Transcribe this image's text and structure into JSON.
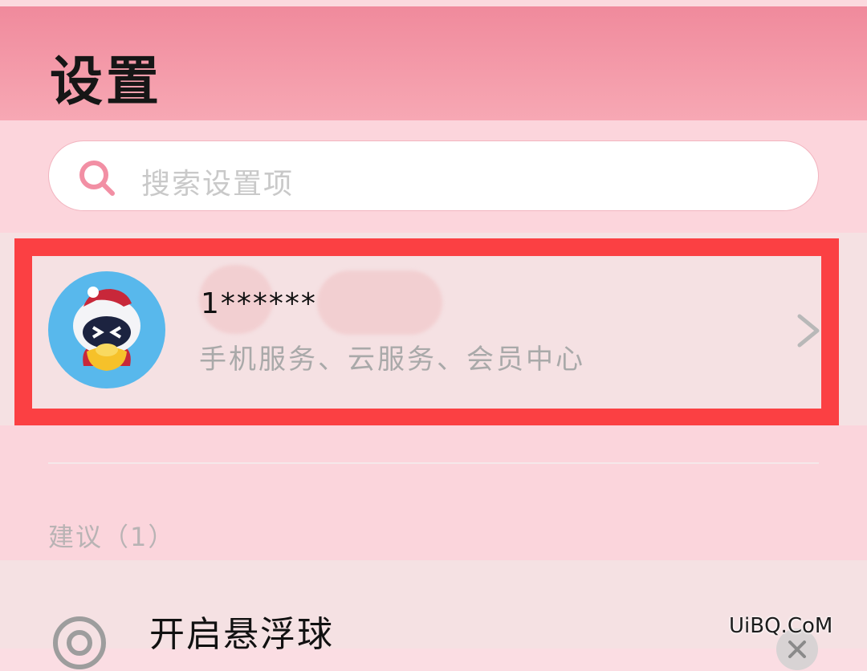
{
  "header": {
    "title": "设置"
  },
  "search": {
    "placeholder": "搜索设置项"
  },
  "account": {
    "name": "1******",
    "subtitle": "手机服务、云服务、会员中心"
  },
  "suggestions": {
    "section_label": "建议（1）",
    "items": [
      {
        "label": "开启悬浮球"
      }
    ]
  },
  "watermark": "UiBQ.CoM",
  "colors": {
    "header": "#f08a9c",
    "highlight": "#fb4043",
    "search_icon": "#f28fa4"
  }
}
